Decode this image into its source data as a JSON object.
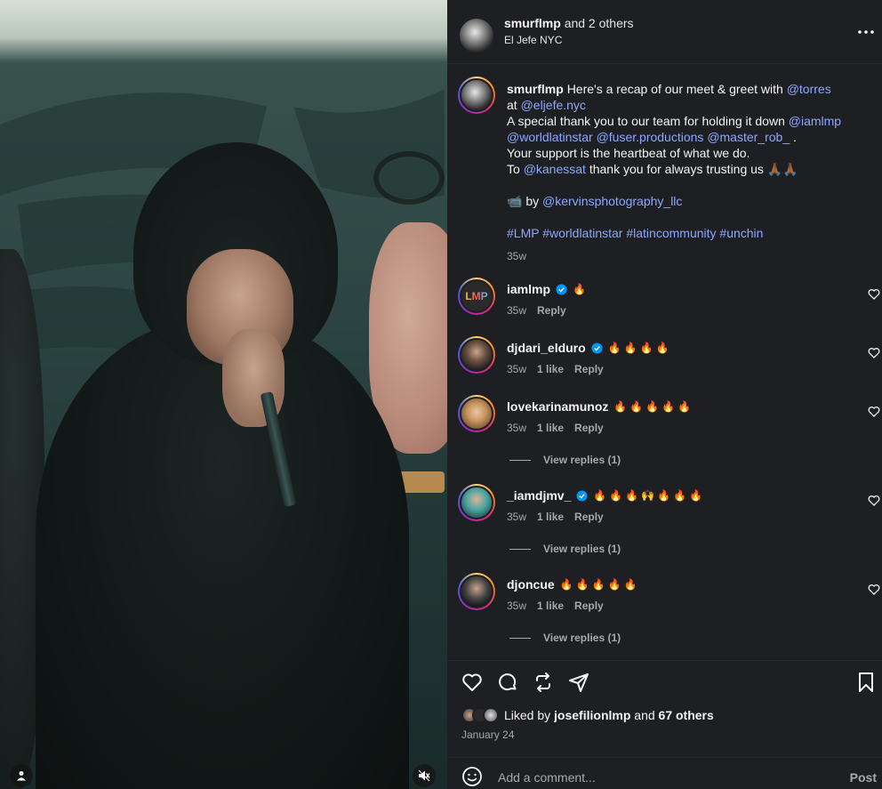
{
  "header": {
    "username": "smurflmp",
    "and_others": "and 2 others",
    "location": "El Jefe NYC"
  },
  "caption": {
    "username": "smurflmp",
    "lines": [
      [
        "Here's a recap of our meet & greet with ",
        "@torres"
      ],
      [
        "at ",
        "@eljefe.nyc"
      ],
      [
        "A special thank you to our team for holding it down ",
        "@iamlmp"
      ],
      [
        "@worldlatinstar",
        " ",
        "@fuser.productions",
        " ",
        "@master_rob_",
        " ."
      ],
      [
        "Your support is the heartbeat of what we do."
      ],
      [
        "To ",
        "@kanessat",
        " thank you for always trusting us 🙏🏾🙏🏾"
      ]
    ],
    "camera_emoji": "📹",
    "by_label": "by",
    "photographer": "@kervinsphotography_llc",
    "hashtags": "#LMP #worldlatinstar #latincommunity #unchin",
    "time": "35w"
  },
  "comments": [
    {
      "username": "iamlmp",
      "verified": true,
      "text": "🔥",
      "time": "35w",
      "likes": "",
      "reply": "Reply",
      "view_replies": ""
    },
    {
      "username": "djdari_elduro",
      "verified": true,
      "text": "🔥🔥🔥🔥",
      "time": "35w",
      "likes": "1 like",
      "reply": "Reply",
      "view_replies": ""
    },
    {
      "username": "lovekarinamunoz",
      "verified": false,
      "text": "🔥🔥🔥🔥🔥",
      "time": "35w",
      "likes": "1 like",
      "reply": "Reply",
      "view_replies": "View replies (1)"
    },
    {
      "username": "_iamdjmv_",
      "verified": true,
      "text": "🔥🔥🔥🙌🔥🔥🔥",
      "time": "35w",
      "likes": "1 like",
      "reply": "Reply",
      "view_replies": "View replies (1)"
    },
    {
      "username": "djoncue",
      "verified": false,
      "text": "🔥🔥🔥🔥🔥",
      "time": "35w",
      "likes": "1 like",
      "reply": "Reply",
      "view_replies": "View replies (1)"
    }
  ],
  "likes": {
    "prefix": "Liked by",
    "user": "josefilionlmp",
    "and_label": "and",
    "others": "67 others"
  },
  "date": "January 24",
  "add_comment": {
    "placeholder": "Add a comment...",
    "post_label": "Post"
  },
  "colors": {
    "panel_bg": "#1e1f23",
    "link": "#8aa8ff",
    "muted": "#a8a8a8",
    "verified": "#0095f6"
  }
}
